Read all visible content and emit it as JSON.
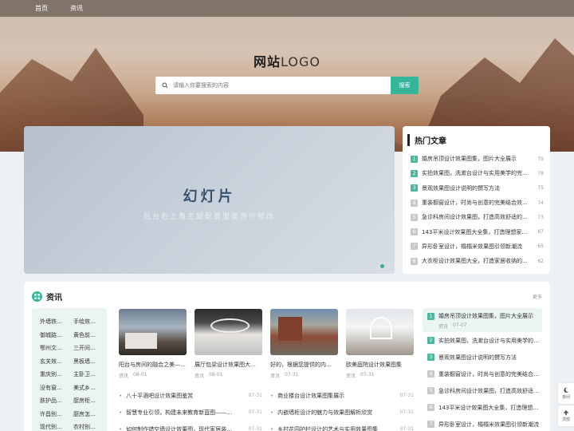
{
  "nav": {
    "items": [
      "首页",
      "资讯"
    ]
  },
  "logo": {
    "bold": "网站",
    "light": "LOGO"
  },
  "search": {
    "placeholder": "请输入你要搜索的内容",
    "button": "搜索"
  },
  "slideshow": {
    "title": "幻灯片",
    "subtitle": "后台右上角主题配置里面自行修改"
  },
  "hot": {
    "title": "热门文章",
    "items": [
      {
        "rank": "1",
        "title": "婚房吊顶设计效果图集，图片大全展示",
        "count": "79"
      },
      {
        "rank": "2",
        "title": "实拍效果图，洗漱台设计与实用美学的完美融合",
        "count": "78"
      },
      {
        "rank": "3",
        "title": "景观效果图设计说明的撰写方法",
        "count": "75"
      },
      {
        "rank": "4",
        "title": "重装橱窗设计，时尚与创意的完美结合效果图",
        "count": "74"
      },
      {
        "rank": "5",
        "title": "急诊科房间设计效果图，打造高效舒适的医疗环境",
        "count": "73"
      },
      {
        "rank": "6",
        "title": "143平米设计效果图大全集，打造理想家居空间",
        "count": "67"
      },
      {
        "rank": "7",
        "title": "异形卧室设计，榻榻米效果图引领新潮流",
        "count": "65"
      },
      {
        "rank": "8",
        "title": "大衣柜设计效果图大全，打造家居收纳的艺术空间",
        "count": "62"
      }
    ]
  },
  "news": {
    "title": "资讯",
    "more": "更多",
    "tags": [
      "外墙铁…",
      "手绘效…",
      "御城路…",
      "黄色前…",
      "鄂州文…",
      "三开间…",
      "玄关效…",
      "黑板墙…",
      "重庆别…",
      "主卧卫…",
      "没有窗…",
      "美式乡…",
      "肤护品…",
      "厨房柜…",
      "许昌别…",
      "厨房怎…",
      "现代别…",
      "农村别…"
    ],
    "cards": [
      {
        "title": "阳台与房间的融合之美——…",
        "tag": "资讯",
        "date": "08-01"
      },
      {
        "title": "展厅包梁设计效果图大…",
        "tag": "资讯",
        "date": "08-01"
      },
      {
        "title": "好的，根据您提供的内…",
        "tag": "资讯",
        "date": "07-31"
      },
      {
        "title": "欧美庭院设计效果图集",
        "tag": "资讯",
        "date": "07-31"
      }
    ],
    "list": [
      {
        "title": "八十平酒吧设计效果图鉴赏",
        "date": "07-31"
      },
      {
        "title": "商业楼台设计效果图集展示",
        "date": "07-31"
      },
      {
        "title": "智慧专业引领，构建未来教育新蓝图——…",
        "date": "07-31"
      },
      {
        "title": "内嵌墙柜设计的魅力与效果图解析欣赏",
        "date": "07-31"
      },
      {
        "title": "如何制作错空墙设计效果图，现代家居装…",
        "date": "07-31"
      },
      {
        "title": "乡村花园护栏设计的艺术与实用效果图集",
        "date": "07-31"
      }
    ],
    "ranking": [
      {
        "rank": "1",
        "title": "婚房吊顶设计效果图集，图片大全展示",
        "tag": "资讯",
        "date": "07-07"
      },
      {
        "rank": "2",
        "title": "实拍效果图，洗漱台设计与实用美学的完美融合"
      },
      {
        "rank": "3",
        "title": "景观效果图设计说明的撰写方法"
      },
      {
        "rank": "4",
        "title": "重装橱窗设计，时尚与创意的完美结合效果图"
      },
      {
        "rank": "5",
        "title": "急诊科房间设计效果图，打造高效舒适的医疗环境"
      },
      {
        "rank": "6",
        "title": "143平米设计效果图大全集，打造理想家居空间"
      },
      {
        "rank": "7",
        "title": "异形卧室设计，榻榻米效果图引领新潮流"
      }
    ]
  },
  "float": {
    "night": "夜间",
    "top": "顶部"
  },
  "colors": {
    "accent": "#35b59a"
  },
  "icons": {
    "search": "search-icon",
    "news": "grid-icon",
    "hot": "fire-icon",
    "night": "moon-icon",
    "top": "arrow-up-icon"
  }
}
